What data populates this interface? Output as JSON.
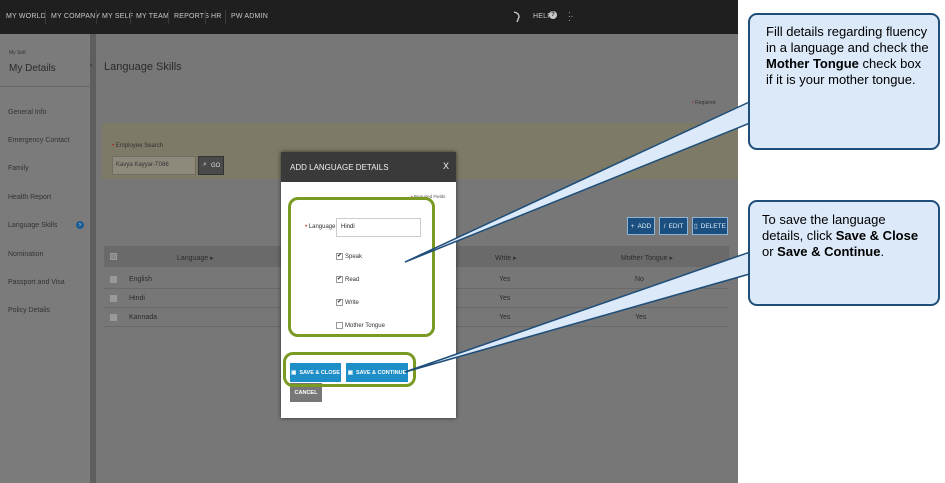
{
  "nav": {
    "items": [
      "MY WORLD",
      "MY COMPANY",
      "MY SELF",
      "MY TEAM",
      "REPORTS",
      "HR",
      "PW ADMIN"
    ],
    "help": "HELP"
  },
  "sidebar": {
    "breadcrumb": "My Self",
    "title": "My Details",
    "items": [
      "General Info",
      "Emergency Contact",
      "Family",
      "Health Report",
      "Language Skills",
      "Nomination",
      "Passport and Visa",
      "Policy Details"
    ]
  },
  "page": {
    "title": "Language Skills",
    "required": "Required",
    "search_label": "Employee Search",
    "search_value": "Kavya Kayyar-T086",
    "go_label": "GO"
  },
  "toolbar": {
    "add": "ADD",
    "edit": "EDIT",
    "delete": "DELETE"
  },
  "table": {
    "headers": {
      "language": "Language",
      "write": "Write",
      "mother_tongue": "Mother Tongue"
    },
    "rows": [
      {
        "language": "English",
        "write": "Yes",
        "mother_tongue": "No"
      },
      {
        "language": "Hindi",
        "write": "Yes",
        "mother_tongue": ""
      },
      {
        "language": "Kannada",
        "write": "Yes",
        "mother_tongue": "Yes"
      }
    ]
  },
  "modal": {
    "title": "ADD LANGUAGE DETAILS",
    "close": "X",
    "required_fields": "Required Fields",
    "language_label": "Language",
    "language_value": "Hindi",
    "speak": "Speak",
    "read": "Read",
    "write": "Write",
    "mother_tongue": "Mother Tongue",
    "save_close": "SAVE & CLOSE",
    "save_continue": "SAVE & CONTINUE",
    "cancel": "CANCEL"
  },
  "callouts": {
    "fluency_1": "Fill details regarding fluency in a  language and check the ",
    "fluency_bold": "Mother Tongue",
    "fluency_2": " check box if it is your  mother tongue.",
    "save_1": "To save the  language details, click ",
    "save_bold1": "Save & Close",
    "save_mid": " or ",
    "save_bold2": "Save & Continue",
    "save_end": "."
  },
  "colors": {
    "accent": "#1d8ec7",
    "highlight": "#7a9a23",
    "callout_bg": "#dbe9f8",
    "callout_border": "#1f4e79"
  }
}
